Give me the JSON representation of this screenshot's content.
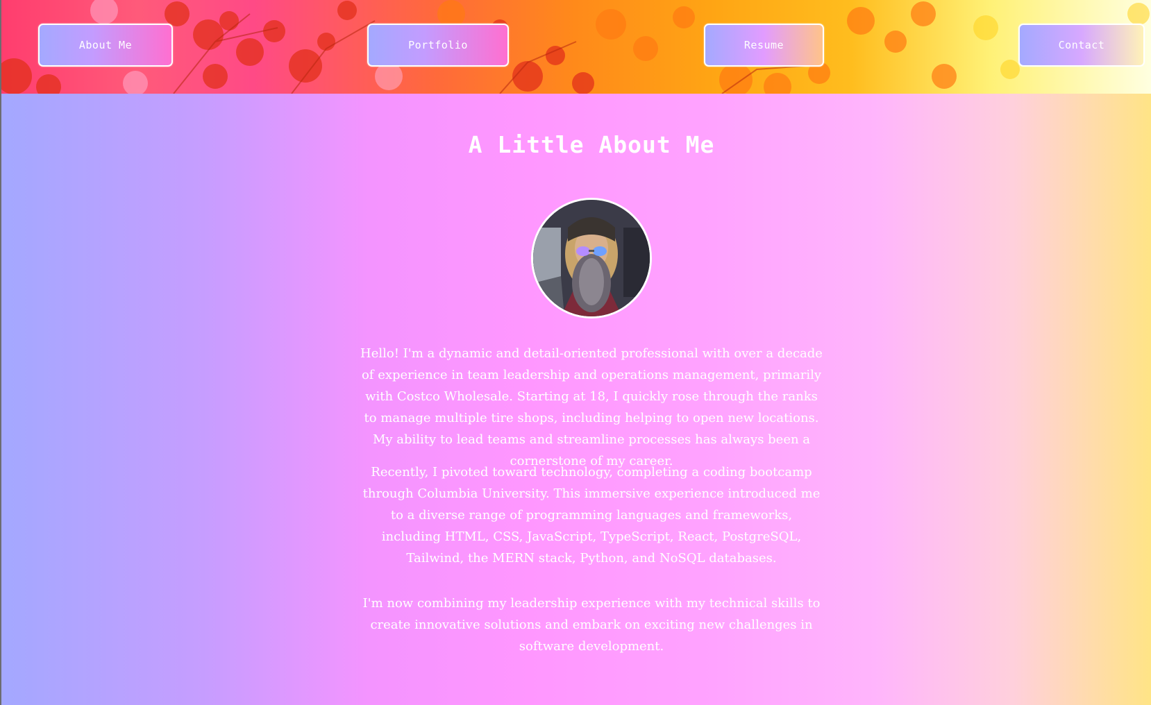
{
  "nav": {
    "about_label": "About Me",
    "portfolio_label": "Portfolio",
    "resume_label": "Resume",
    "contact_label": "Contact"
  },
  "about": {
    "title": "A Little About Me",
    "paragraphs": [
      "Hello! I'm a dynamic and detail-oriented professional with over a decade of experience in team leadership and operations management, primarily with Costco Wholesale. Starting at 18, I quickly rose through the ranks to manage multiple tire shops, including helping to open new locations. My ability to lead teams and streamline processes has always been a cornerstone of my career.",
      "Recently, I pivoted toward technology, completing a coding bootcamp through Columbia University. This immersive experience introduced me to a diverse range of programming languages and frameworks, including HTML, CSS, JavaScript, TypeScript, React, PostgreSQL, Tailwind, the MERN stack, Python, and NoSQL databases.",
      "I'm now combining my leadership experience with my technical skills to create innovative solutions and embark on exciting new challenges in software development."
    ]
  },
  "colors": {
    "header_pink": "#ff3d6e",
    "header_orange": "#ff8a1a",
    "header_yellow": "#fff176",
    "main_periwinkle": "#a3a8ff",
    "main_pink": "#ff97ff",
    "main_yellow": "#ffe486",
    "text": "#ffffff"
  },
  "icons": {
    "header_background": "foliage-photo",
    "avatar": "profile-photo"
  }
}
